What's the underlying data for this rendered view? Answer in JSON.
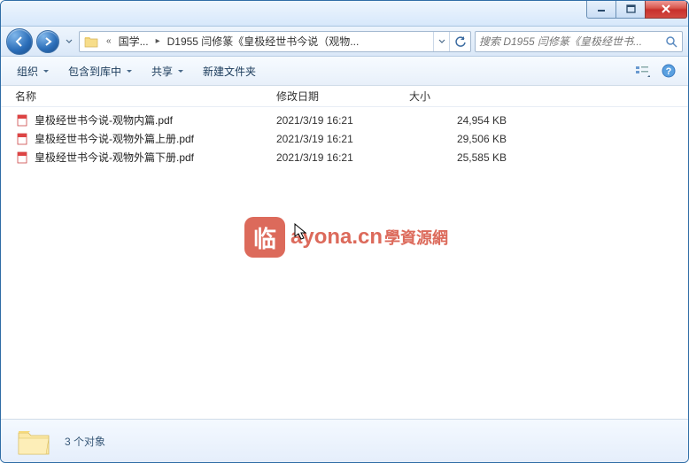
{
  "breadcrumb": {
    "seg1": "国学...",
    "seg2": "D1955 闫修篆《皇极经世书今说（观物..."
  },
  "search": {
    "placeholder": "搜索 D1955 闫修篆《皇极经世书..."
  },
  "toolbar": {
    "organize": "组织",
    "include": "包含到库中",
    "share": "共享",
    "newfolder": "新建文件夹"
  },
  "columns": {
    "name": "名称",
    "modified": "修改日期",
    "size": "大小"
  },
  "files": [
    {
      "name": "皇极经世书今说-观物内篇.pdf",
      "date": "2021/3/19 16:21",
      "size": "24,954 KB"
    },
    {
      "name": "皇极经世书今说-观物外篇上册.pdf",
      "date": "2021/3/19 16:21",
      "size": "29,506 KB"
    },
    {
      "name": "皇极经世书今说-观物外篇下册.pdf",
      "date": "2021/3/19 16:21",
      "size": "25,585 KB"
    }
  ],
  "status": {
    "count": "3 个对象"
  },
  "watermark": {
    "box": "临",
    "main": "ayona.cn",
    "sub": "學資源網"
  }
}
